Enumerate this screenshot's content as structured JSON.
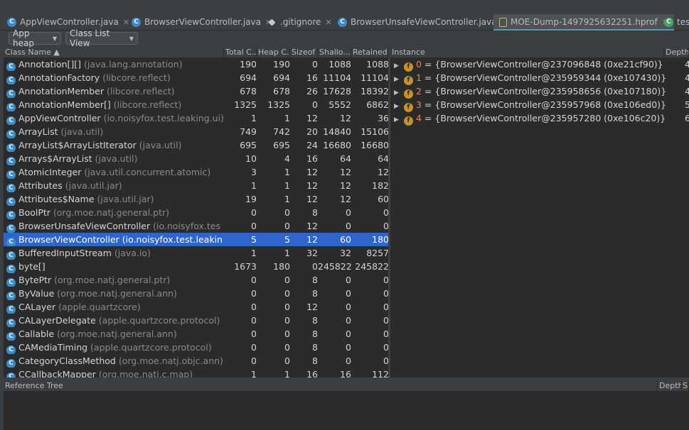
{
  "tabs": [
    {
      "label": "AppViewController.java",
      "icon": "class-icon",
      "active": false
    },
    {
      "label": "BrowserViewController.java",
      "icon": "class-icon",
      "active": false
    },
    {
      "label": ".gitignore",
      "icon": "git-icon",
      "active": false
    },
    {
      "label": "BrowserUnsafeViewController.java",
      "icon": "class-icon",
      "active": false
    },
    {
      "label": "MOE-Dump-1497925632251.hprof",
      "icon": "hprof-file-icon",
      "active": true
    },
    {
      "label": "tes",
      "icon": "test-icon",
      "active": false
    }
  ],
  "toolbar": {
    "heap_combo": "App heap",
    "view_combo": "Class List View"
  },
  "class_table": {
    "headers": [
      "Class Name ▲",
      "Total C...",
      "Heap C...",
      "Sizeof",
      "Shallo...",
      "Retained..."
    ],
    "selected_row": 13,
    "rows": [
      {
        "name": "Annotation[][]",
        "pkg": "(java.lang.annotation)",
        "total": "190",
        "heap": "190",
        "sizeof": "0",
        "shallow": "1088",
        "retained": "1088"
      },
      {
        "name": "AnnotationFactory",
        "pkg": "(libcore.reflect)",
        "total": "694",
        "heap": "694",
        "sizeof": "16",
        "shallow": "11104",
        "retained": "11104"
      },
      {
        "name": "AnnotationMember",
        "pkg": "(libcore.reflect)",
        "total": "678",
        "heap": "678",
        "sizeof": "26",
        "shallow": "17628",
        "retained": "18392"
      },
      {
        "name": "AnnotationMember[]",
        "pkg": "(libcore.reflect)",
        "total": "1325",
        "heap": "1325",
        "sizeof": "0",
        "shallow": "5552",
        "retained": "6862"
      },
      {
        "name": "AppViewController",
        "pkg": "(io.noisyfox.test.leaking.ui)",
        "total": "1",
        "heap": "1",
        "sizeof": "12",
        "shallow": "12",
        "retained": "36"
      },
      {
        "name": "ArrayList",
        "pkg": "(java.util)",
        "total": "749",
        "heap": "742",
        "sizeof": "20",
        "shallow": "14840",
        "retained": "15106"
      },
      {
        "name": "ArrayList$ArrayListIterator",
        "pkg": "(java.util)",
        "total": "695",
        "heap": "695",
        "sizeof": "24",
        "shallow": "16680",
        "retained": "16680"
      },
      {
        "name": "Arrays$ArrayList",
        "pkg": "(java.util)",
        "total": "10",
        "heap": "4",
        "sizeof": "16",
        "shallow": "64",
        "retained": "64"
      },
      {
        "name": "AtomicInteger",
        "pkg": "(java.util.concurrent.atomic)",
        "total": "3",
        "heap": "1",
        "sizeof": "12",
        "shallow": "12",
        "retained": "12"
      },
      {
        "name": "Attributes",
        "pkg": "(java.util.jar)",
        "total": "1",
        "heap": "1",
        "sizeof": "12",
        "shallow": "12",
        "retained": "182"
      },
      {
        "name": "Attributes$Name",
        "pkg": "(java.util.jar)",
        "total": "19",
        "heap": "1",
        "sizeof": "12",
        "shallow": "12",
        "retained": "60"
      },
      {
        "name": "BoolPtr",
        "pkg": "(org.moe.natj.general.ptr)",
        "total": "0",
        "heap": "0",
        "sizeof": "8",
        "shallow": "0",
        "retained": "0"
      },
      {
        "name": "BrowserUnsafeViewController",
        "pkg": "(io.noisyfox.tes",
        "total": "0",
        "heap": "0",
        "sizeof": "12",
        "shallow": "0",
        "retained": "0"
      },
      {
        "name": "BrowserViewController",
        "pkg": "(io.noisyfox.test.leakin",
        "total": "5",
        "heap": "5",
        "sizeof": "12",
        "shallow": "60",
        "retained": "180"
      },
      {
        "name": "BufferedInputStream",
        "pkg": "(java.io)",
        "total": "1",
        "heap": "1",
        "sizeof": "32",
        "shallow": "32",
        "retained": "8257"
      },
      {
        "name": "byte[]",
        "pkg": "",
        "total": "1673",
        "heap": "180",
        "sizeof": "0",
        "shallow": "245822",
        "retained": "245822"
      },
      {
        "name": "BytePtr",
        "pkg": "(org.moe.natj.general.ptr)",
        "total": "0",
        "heap": "0",
        "sizeof": "8",
        "shallow": "0",
        "retained": "0"
      },
      {
        "name": "ByValue",
        "pkg": "(org.moe.natj.general.ann)",
        "total": "0",
        "heap": "0",
        "sizeof": "8",
        "shallow": "0",
        "retained": "0"
      },
      {
        "name": "CALayer",
        "pkg": "(apple.quartzcore)",
        "total": "0",
        "heap": "0",
        "sizeof": "12",
        "shallow": "0",
        "retained": "0"
      },
      {
        "name": "CALayerDelegate",
        "pkg": "(apple.quartzcore.protocol)",
        "total": "0",
        "heap": "0",
        "sizeof": "8",
        "shallow": "0",
        "retained": "0"
      },
      {
        "name": "Callable",
        "pkg": "(org.moe.natj.general.ann)",
        "total": "0",
        "heap": "0",
        "sizeof": "8",
        "shallow": "0",
        "retained": "0"
      },
      {
        "name": "CAMediaTiming",
        "pkg": "(apple.quartzcore.protocol)",
        "total": "0",
        "heap": "0",
        "sizeof": "8",
        "shallow": "0",
        "retained": "0"
      },
      {
        "name": "CategoryClassMethod",
        "pkg": "(org.moe.natj.objc.ann)",
        "total": "0",
        "heap": "0",
        "sizeof": "8",
        "shallow": "0",
        "retained": "0"
      },
      {
        "name": "CCallbackMapper",
        "pkg": "(org.moe.natj.c.map)",
        "total": "1",
        "heap": "1",
        "sizeof": "16",
        "shallow": "16",
        "retained": "112"
      }
    ]
  },
  "instance_table": {
    "headers": [
      "Instance",
      "Depth"
    ],
    "rows": [
      {
        "index": "0",
        "value": " = {BrowserViewController@237096848 (0xe21cf90)}",
        "depth": "4"
      },
      {
        "index": "1",
        "value": " = {BrowserViewController@235959344 (0xe107430)}",
        "depth": "4"
      },
      {
        "index": "2",
        "value": " = {BrowserViewController@235958656 (0xe107180)}",
        "depth": "4"
      },
      {
        "index": "3",
        "value": " = {BrowserViewController@235957968 (0xe106ed0)}",
        "depth": "5"
      },
      {
        "index": "4",
        "value": " = {BrowserViewController@235957280 (0xe106c20)}",
        "depth": "6"
      }
    ]
  },
  "reference_tree": {
    "header": "Reference Tree",
    "col_depth": "Depth",
    "col_sh": "Sh"
  }
}
